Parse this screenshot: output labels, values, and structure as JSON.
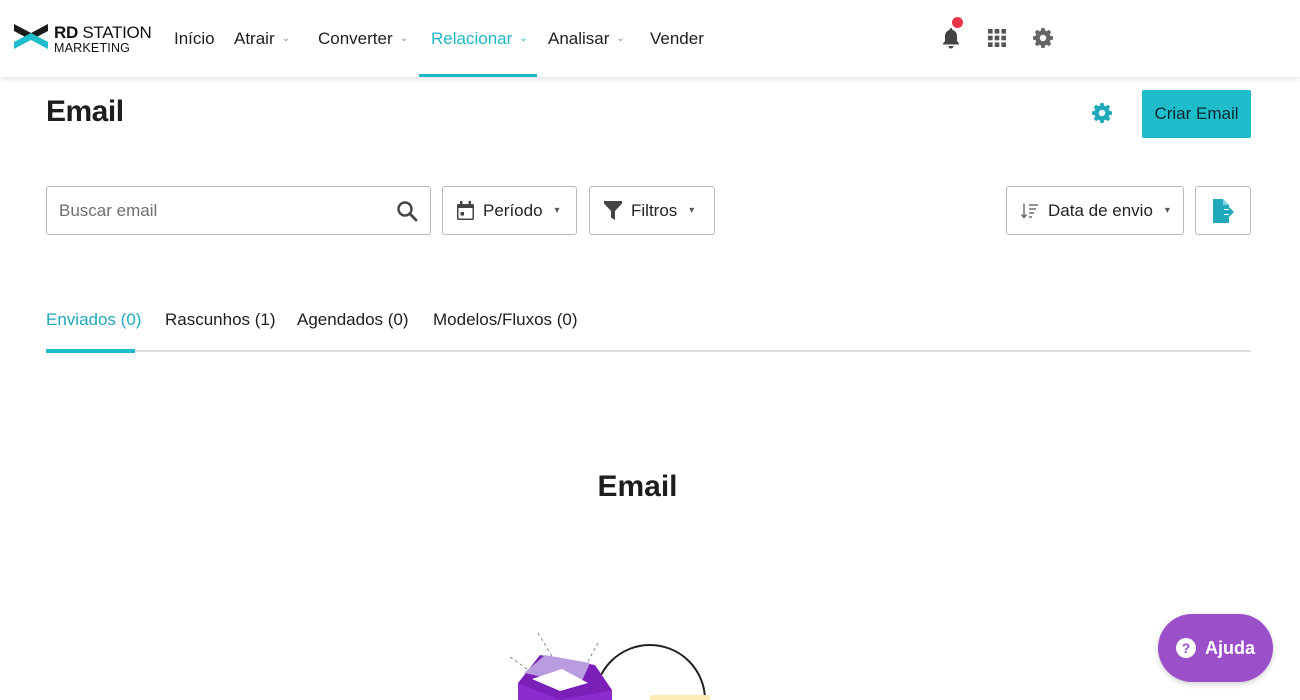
{
  "logo": {
    "line1_bold": "RD",
    "line1_rest": " STATION",
    "line2": "MARKETING",
    "icon": "rd-station-chevrons-icon"
  },
  "nav": {
    "items": [
      {
        "label": "Início",
        "dropdown": false
      },
      {
        "label": "Atrair",
        "dropdown": true
      },
      {
        "label": "Converter",
        "dropdown": true
      },
      {
        "label": "Relacionar",
        "dropdown": true,
        "active": true
      },
      {
        "label": "Analisar",
        "dropdown": true
      },
      {
        "label": "Vender",
        "dropdown": false
      }
    ],
    "chevron": "⌄",
    "icons": [
      "bell-icon",
      "apps-grid-icon",
      "gear-icon"
    ]
  },
  "page": {
    "title": "Email",
    "create_button": "Criar Email"
  },
  "toolbar": {
    "search_placeholder": "Buscar email",
    "period_label": "Período",
    "filters_label": "Filtros",
    "sort_label": "Data de envio",
    "caret": "▾"
  },
  "tabs": [
    {
      "label": "Enviados (0)",
      "active": true
    },
    {
      "label": "Rascunhos (1)"
    },
    {
      "label": "Agendados (0)"
    },
    {
      "label": "Modelos/Fluxos (0)"
    }
  ],
  "empty_state": {
    "title": "Email"
  },
  "help": {
    "label": "Ajuda",
    "icon_glyph": "?"
  },
  "colors": {
    "accent": "#1fbdcc",
    "help": "#9b4fc9",
    "notification": "#e8334a"
  }
}
